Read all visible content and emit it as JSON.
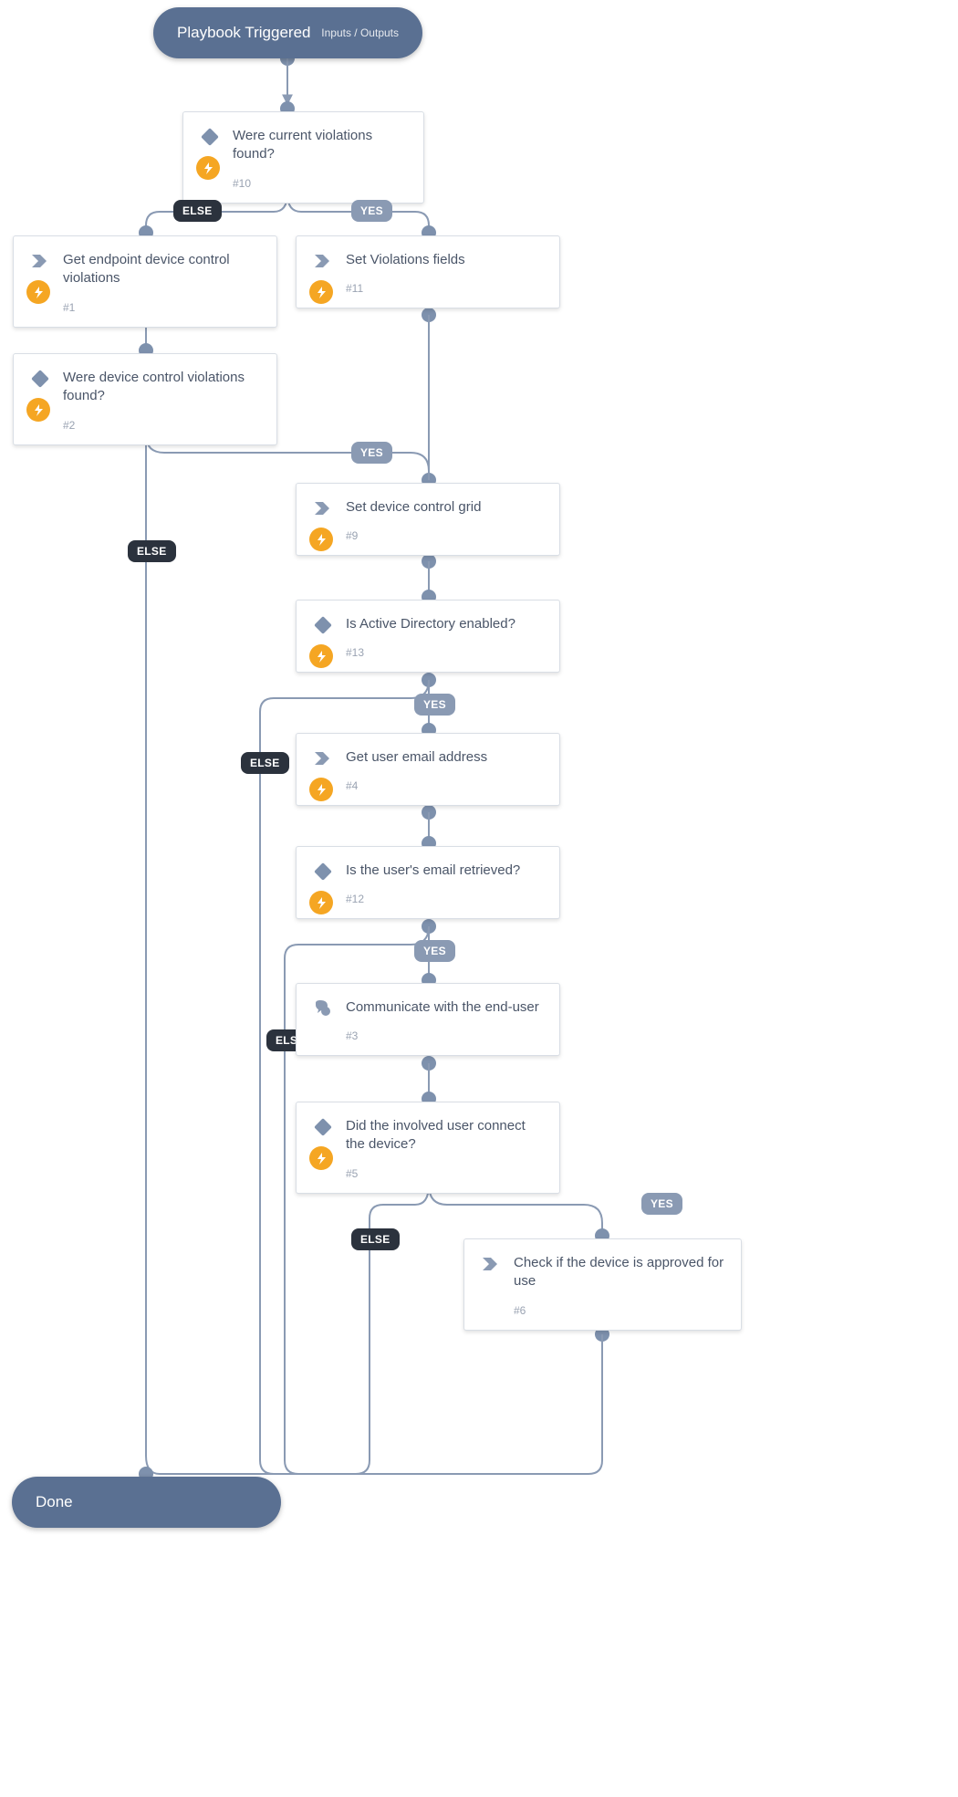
{
  "trigger": {
    "title": "Playbook Triggered",
    "sub": "Inputs / Outputs"
  },
  "done": {
    "title": "Done"
  },
  "labels": {
    "yes": "YES",
    "else": "ELSE"
  },
  "nodes": {
    "n10": {
      "title": "Were current violations found?",
      "num": "#10",
      "icon": "diamond",
      "bolt": true
    },
    "n1": {
      "title": "Get endpoint device control violations",
      "num": "#1",
      "icon": "chevron",
      "bolt": true
    },
    "n11": {
      "title": "Set Violations fields",
      "num": "#11",
      "icon": "chevron",
      "bolt": true
    },
    "n2": {
      "title": "Were device control violations found?",
      "num": "#2",
      "icon": "diamond",
      "bolt": true
    },
    "n9": {
      "title": "Set device control grid",
      "num": "#9",
      "icon": "chevron",
      "bolt": true
    },
    "n13": {
      "title": "Is Active Directory enabled?",
      "num": "#13",
      "icon": "diamond",
      "bolt": true
    },
    "n4": {
      "title": "Get user email address",
      "num": "#4",
      "icon": "chevron",
      "bolt": true
    },
    "n12": {
      "title": "Is the user's email retrieved?",
      "num": "#12",
      "icon": "diamond",
      "bolt": true
    },
    "n3": {
      "title": "Communicate with the end-user",
      "num": "#3",
      "icon": "chat",
      "bolt": false
    },
    "n5": {
      "title": "Did the involved user connect the device?",
      "num": "#5",
      "icon": "diamond",
      "bolt": true
    },
    "n6": {
      "title": "Check if the device is approved for use",
      "num": "#6",
      "icon": "chevron",
      "bolt": false
    }
  },
  "colors": {
    "node_border": "#d9dee5",
    "connector": "#8a9ab3",
    "pill_bg": "#5a7092",
    "else_bg": "#2b323d",
    "yes_bg": "#8a9ab3",
    "bolt_bg": "#f5a623"
  }
}
